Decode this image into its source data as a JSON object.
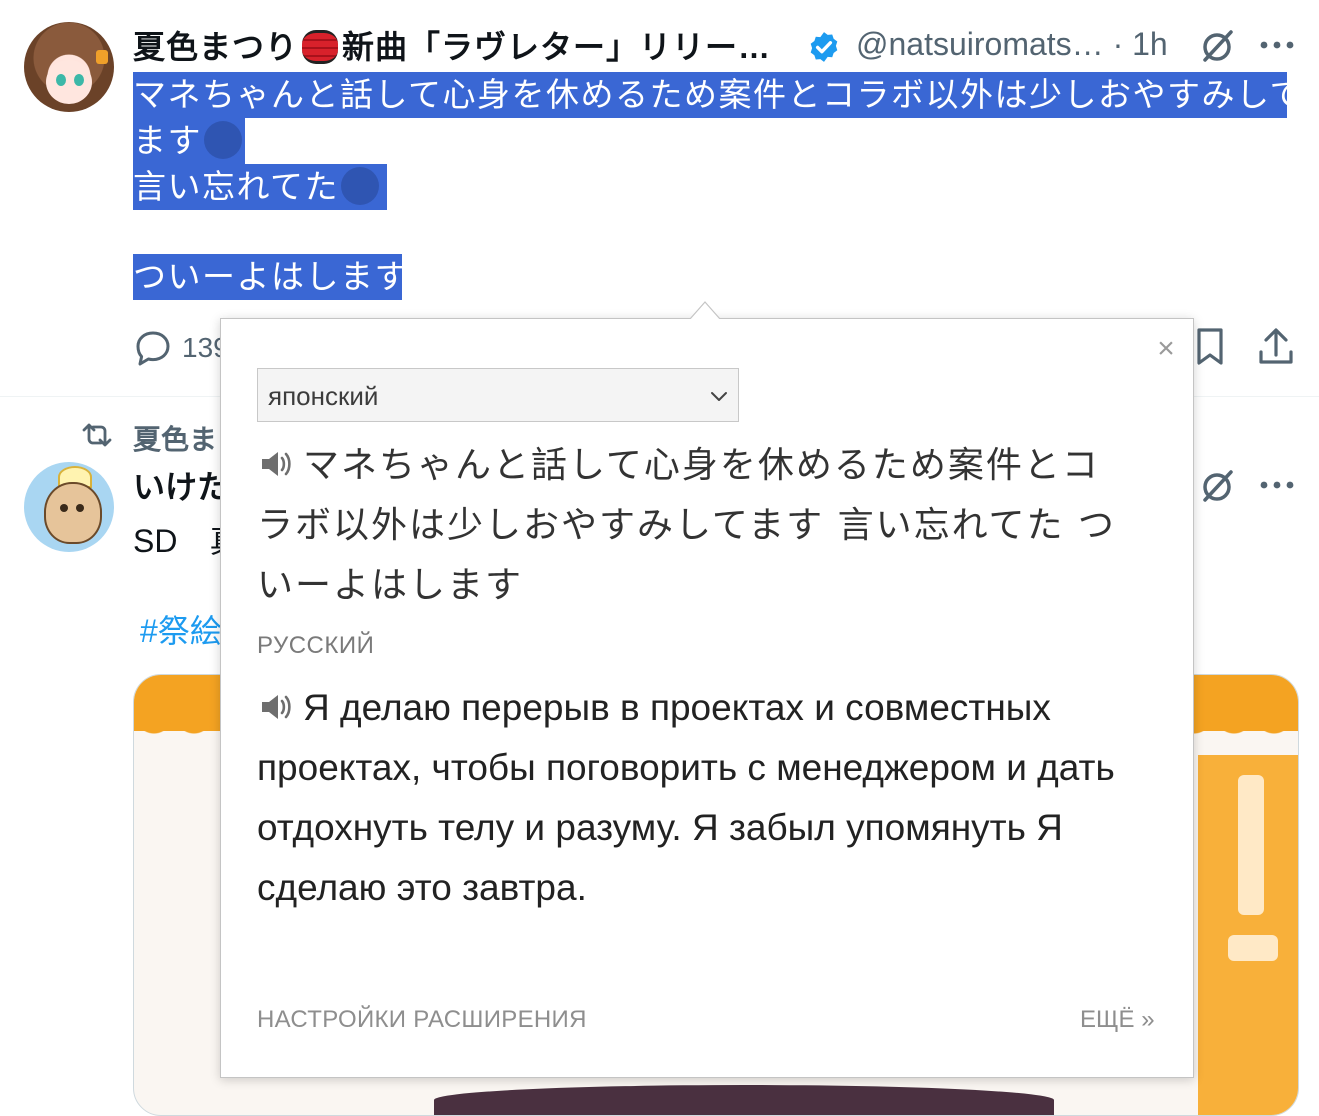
{
  "tweet1": {
    "author_name_part1": "夏色まつり",
    "author_name_part2": "新曲「ラヴレター」リリー…",
    "handle": "@natsuiromats…",
    "time": "· 1h",
    "selected_lines": [
      "マネちゃんと話して心身を休めるため案件とコラボ以外は少しおやすみして",
      "ます",
      "言い忘れてた",
      "",
      "ついーよはします"
    ],
    "reply_count": "139"
  },
  "tweet2": {
    "retweet_label": "夏色ま",
    "author_name": "いけた",
    "text": "SD　真",
    "hashtag": "#祭絵"
  },
  "translator": {
    "source_language": "японский",
    "source_text": "マネちゃんと話して心身を休めるため案件とコラボ以外は少しおやすみしてます 言い忘れてた ついーよはします",
    "target_language_label": "РУССКИЙ",
    "target_text": "Я делаю перерыв в проектах и совместных проектах, чтобы поговорить с менеджером и дать отдохнуть телу и разуму. Я забыл упомянуть Я сделаю это завтра.",
    "close_symbol": "×",
    "settings_link": "НАСТРОЙКИ РАСШИРЕНИЯ",
    "more_link": "ЕЩЁ »"
  },
  "icons": {
    "verified": "verified-badge-icon",
    "grok": "grok-icon",
    "more": "more-icon",
    "reply": "reply-icon",
    "bookmark": "bookmark-icon",
    "share": "share-icon",
    "retweet": "retweet-icon",
    "speaker": "speaker-icon",
    "chevron": "chevron-down-icon"
  },
  "colors": {
    "selection": "#3a67d4",
    "verified": "#1d9bf0",
    "hashtag": "#1d9bf0",
    "muted": "#536471"
  }
}
